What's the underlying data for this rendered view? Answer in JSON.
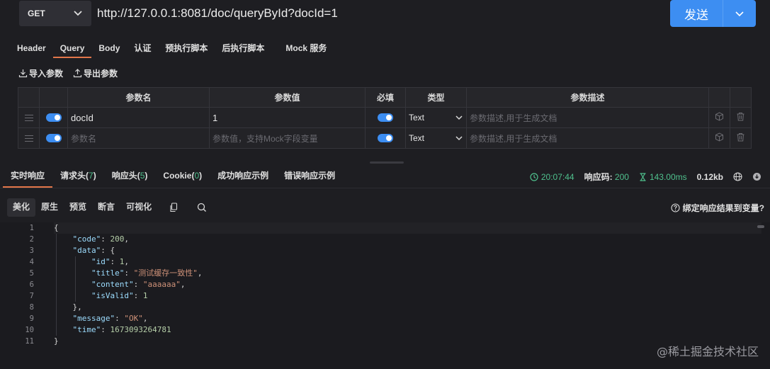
{
  "request": {
    "method": "GET",
    "url": "http://127.0.0.1:8081/doc/queryById?docId=1",
    "send_label": "发送"
  },
  "request_tabs": [
    "Header",
    "Query",
    "Body",
    "认证",
    "预执行脚本",
    "后执行脚本",
    "Mock 服务"
  ],
  "param_actions": {
    "import": "导入参数",
    "export": "导出参数"
  },
  "params_table": {
    "headers": [
      "参数名",
      "参数值",
      "必填",
      "类型",
      "参数描述"
    ],
    "rows": [
      {
        "name": "docId",
        "value": "1",
        "required": true,
        "type": "Text",
        "desc_placeholder": "参数描述,用于生成文档"
      }
    ],
    "new_row": {
      "name_placeholder": "参数名",
      "value_placeholder": "参数值，支持Mock字段变量",
      "required": true,
      "type": "Text",
      "desc_placeholder": "参数描述,用于生成文档"
    }
  },
  "response_tabs": {
    "realtime": "实时响应",
    "req_headers": "请求头",
    "req_headers_count": "7",
    "res_headers": "响应头",
    "res_headers_count": "5",
    "cookie": "Cookie",
    "cookie_count": "0",
    "success_example": "成功响应示例",
    "error_example": "错误响应示例"
  },
  "response_stats": {
    "time": "20:07:44",
    "status_label": "响应码:",
    "status_code": "200",
    "duration": "143.00ms",
    "size": "0.12kb"
  },
  "view_tabs": [
    "美化",
    "原生",
    "预览",
    "断言",
    "可视化"
  ],
  "bind_link": "绑定响应结果到变量?",
  "code_lines": [
    {
      "ln": "1",
      "indent": 0,
      "parts": [
        [
          "p",
          "{"
        ]
      ]
    },
    {
      "ln": "2",
      "indent": 1,
      "parts": [
        [
          "k",
          "\"code\""
        ],
        [
          "p",
          ": "
        ],
        [
          "n",
          "200"
        ],
        [
          "p",
          ","
        ]
      ]
    },
    {
      "ln": "3",
      "indent": 1,
      "parts": [
        [
          "k",
          "\"data\""
        ],
        [
          "p",
          ": {"
        ]
      ]
    },
    {
      "ln": "4",
      "indent": 2,
      "parts": [
        [
          "k",
          "\"id\""
        ],
        [
          "p",
          ": "
        ],
        [
          "n",
          "1"
        ],
        [
          "p",
          ","
        ]
      ]
    },
    {
      "ln": "5",
      "indent": 2,
      "parts": [
        [
          "k",
          "\"title\""
        ],
        [
          "p",
          ": "
        ],
        [
          "s",
          "\"测试缓存一致性\""
        ],
        [
          "p",
          ","
        ]
      ]
    },
    {
      "ln": "6",
      "indent": 2,
      "parts": [
        [
          "k",
          "\"content\""
        ],
        [
          "p",
          ": "
        ],
        [
          "s",
          "\"aaaaaa\""
        ],
        [
          "p",
          ","
        ]
      ]
    },
    {
      "ln": "7",
      "indent": 2,
      "parts": [
        [
          "k",
          "\"isValid\""
        ],
        [
          "p",
          ": "
        ],
        [
          "n",
          "1"
        ]
      ]
    },
    {
      "ln": "8",
      "indent": 1,
      "parts": [
        [
          "p",
          "},"
        ]
      ]
    },
    {
      "ln": "9",
      "indent": 1,
      "parts": [
        [
          "k",
          "\"message\""
        ],
        [
          "p",
          ": "
        ],
        [
          "s",
          "\"OK\""
        ],
        [
          "p",
          ","
        ]
      ]
    },
    {
      "ln": "10",
      "indent": 1,
      "parts": [
        [
          "k",
          "\"time\""
        ],
        [
          "p",
          ": "
        ],
        [
          "n",
          "1673093264781"
        ]
      ]
    },
    {
      "ln": "11",
      "indent": 0,
      "parts": [
        [
          "p",
          "}"
        ]
      ]
    }
  ],
  "watermark": "@稀土掘金技术社区",
  "colors": {
    "accent": "#3d8ef2",
    "tab_underline": "#e2764a",
    "success": "#4fc08d"
  }
}
